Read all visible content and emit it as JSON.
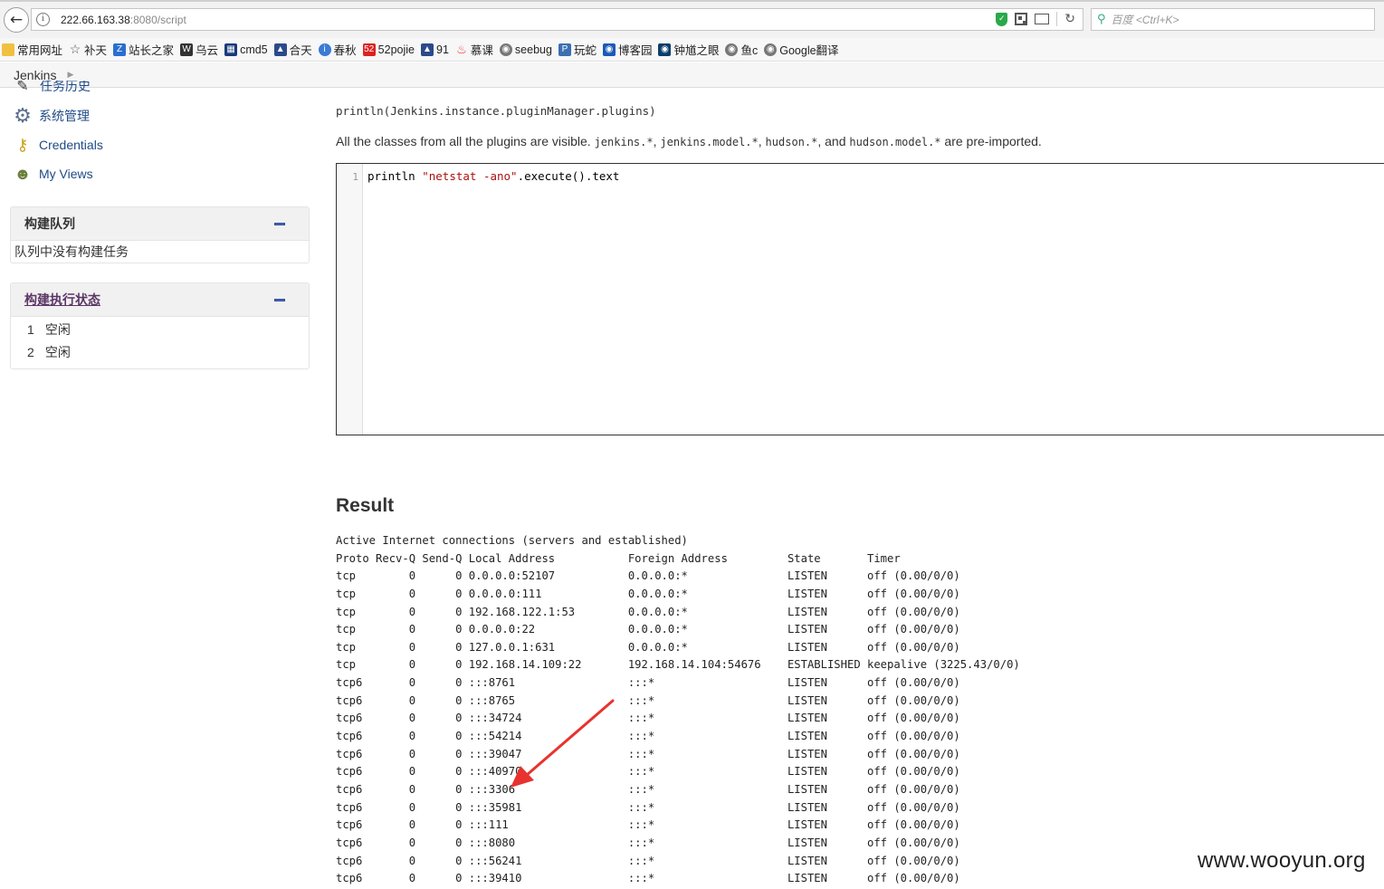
{
  "browser": {
    "url_host": "222.66.163.38",
    "url_path": ":8080/script",
    "search_placeholder": "百度 <Ctrl+K>",
    "bookmarks": [
      "常用网址",
      "补天",
      "站长之家",
      "乌云",
      "cmd5",
      "合天",
      "春秋",
      "52pojie",
      "91",
      "慕课",
      "seebug",
      "玩蛇",
      "博客园",
      "钟馗之眼",
      "鱼c",
      "Google翻译"
    ]
  },
  "breadcrumb": {
    "root": "Jenkins"
  },
  "sidebar": {
    "tasks": [
      {
        "label": "任务历史",
        "icon": "notepad-icon"
      },
      {
        "label": "系统管理",
        "icon": "gear-icon"
      },
      {
        "label": "Credentials",
        "icon": "key-icon"
      },
      {
        "label": "My Views",
        "icon": "users-icon"
      }
    ],
    "build_queue": {
      "title": "构建队列",
      "empty_text": "队列中没有构建任务"
    },
    "executors": {
      "title": "构建执行状态",
      "items": [
        {
          "num": "1",
          "status": "空闲"
        },
        {
          "num": "2",
          "status": "空闲"
        }
      ]
    }
  },
  "main": {
    "sample_code": "println(Jenkins.instance.pluginManager.plugins)",
    "desc_prefix": "All the classes from all the plugins are visible.",
    "desc_pkg1": "jenkins.*",
    "desc_pkg2": "jenkins.model.*",
    "desc_pkg3": "hudson.*",
    "desc_and": "and",
    "desc_pkg4": "hudson.model.*",
    "desc_suffix": "are pre-imported.",
    "editor": {
      "line_number": "1",
      "code_prefix": "println ",
      "code_string": "\"netstat -ano\"",
      "code_suffix": ".execute().text"
    },
    "result_title": "Result",
    "result_lines": [
      "Active Internet connections (servers and established)",
      "Proto Recv-Q Send-Q Local Address           Foreign Address         State       Timer",
      "tcp        0      0 0.0.0.0:52107           0.0.0.0:*               LISTEN      off (0.00/0/0)",
      "tcp        0      0 0.0.0.0:111             0.0.0.0:*               LISTEN      off (0.00/0/0)",
      "tcp        0      0 192.168.122.1:53        0.0.0.0:*               LISTEN      off (0.00/0/0)",
      "tcp        0      0 0.0.0.0:22              0.0.0.0:*               LISTEN      off (0.00/0/0)",
      "tcp        0      0 127.0.0.1:631           0.0.0.0:*               LISTEN      off (0.00/0/0)",
      "tcp        0      0 192.168.14.109:22       192.168.14.104:54676    ESTABLISHED keepalive (3225.43/0/0)",
      "tcp6       0      0 :::8761                 :::*                    LISTEN      off (0.00/0/0)",
      "tcp6       0      0 :::8765                 :::*                    LISTEN      off (0.00/0/0)",
      "tcp6       0      0 :::34724                :::*                    LISTEN      off (0.00/0/0)",
      "tcp6       0      0 :::54214                :::*                    LISTEN      off (0.00/0/0)",
      "tcp6       0      0 :::39047                :::*                    LISTEN      off (0.00/0/0)",
      "tcp6       0      0 :::40970                :::*                    LISTEN      off (0.00/0/0)",
      "tcp6       0      0 :::3306                 :::*                    LISTEN      off (0.00/0/0)",
      "tcp6       0      0 :::35981                :::*                    LISTEN      off (0.00/0/0)",
      "tcp6       0      0 :::111                  :::*                    LISTEN      off (0.00/0/0)",
      "tcp6       0      0 :::8080                 :::*                    LISTEN      off (0.00/0/0)",
      "tcp6       0      0 :::56241                :::*                    LISTEN      off (0.00/0/0)",
      "tcp6       0      0 :::39410                :::*                    LISTEN      off (0.00/0/0)"
    ]
  },
  "watermark": "www.wooyun.org",
  "colors": {
    "link": "#204a87",
    "arrow": "#e8322f",
    "string_literal": "#aa1111"
  }
}
